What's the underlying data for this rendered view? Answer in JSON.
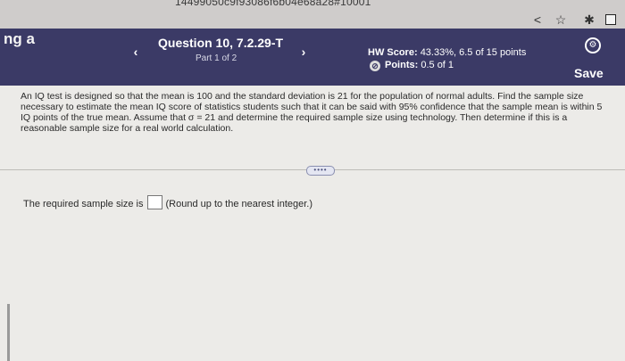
{
  "browser": {
    "url_fragment": "14499050c9f93086f6b04e68a28#10001",
    "share_icon": "share-icon",
    "star_icon": "star-icon",
    "extension_icon": "puzzle-icon"
  },
  "header": {
    "side_text": "ng a",
    "question_title": "Question 10, 7.2.29-T",
    "part_label": "Part 1 of 2",
    "hw_score_label": "HW Score:",
    "hw_score_value": "43.33%, 6.5 of 15 points",
    "points_label": "Points:",
    "points_value": "0.5 of 1",
    "save_label": "Save",
    "prev_icon": "‹",
    "next_icon": "›",
    "colors": {
      "band": "#3b3a66"
    }
  },
  "problem": {
    "text": "An IQ test is designed so that the mean is 100 and the standard deviation is 21 for the population of normal adults. Find the sample size necessary to estimate the mean IQ score of statistics students such that it can be said with 95% confidence that the sample mean is within 5 IQ points of the true mean. Assume that σ = 21 and determine the required sample size using technology. Then determine if this is a reasonable sample size for a real world calculation."
  },
  "more_button_label": "••••",
  "answer": {
    "prefix": "The required sample size is",
    "value": "",
    "suffix": "(Round up to the nearest integer.)"
  }
}
